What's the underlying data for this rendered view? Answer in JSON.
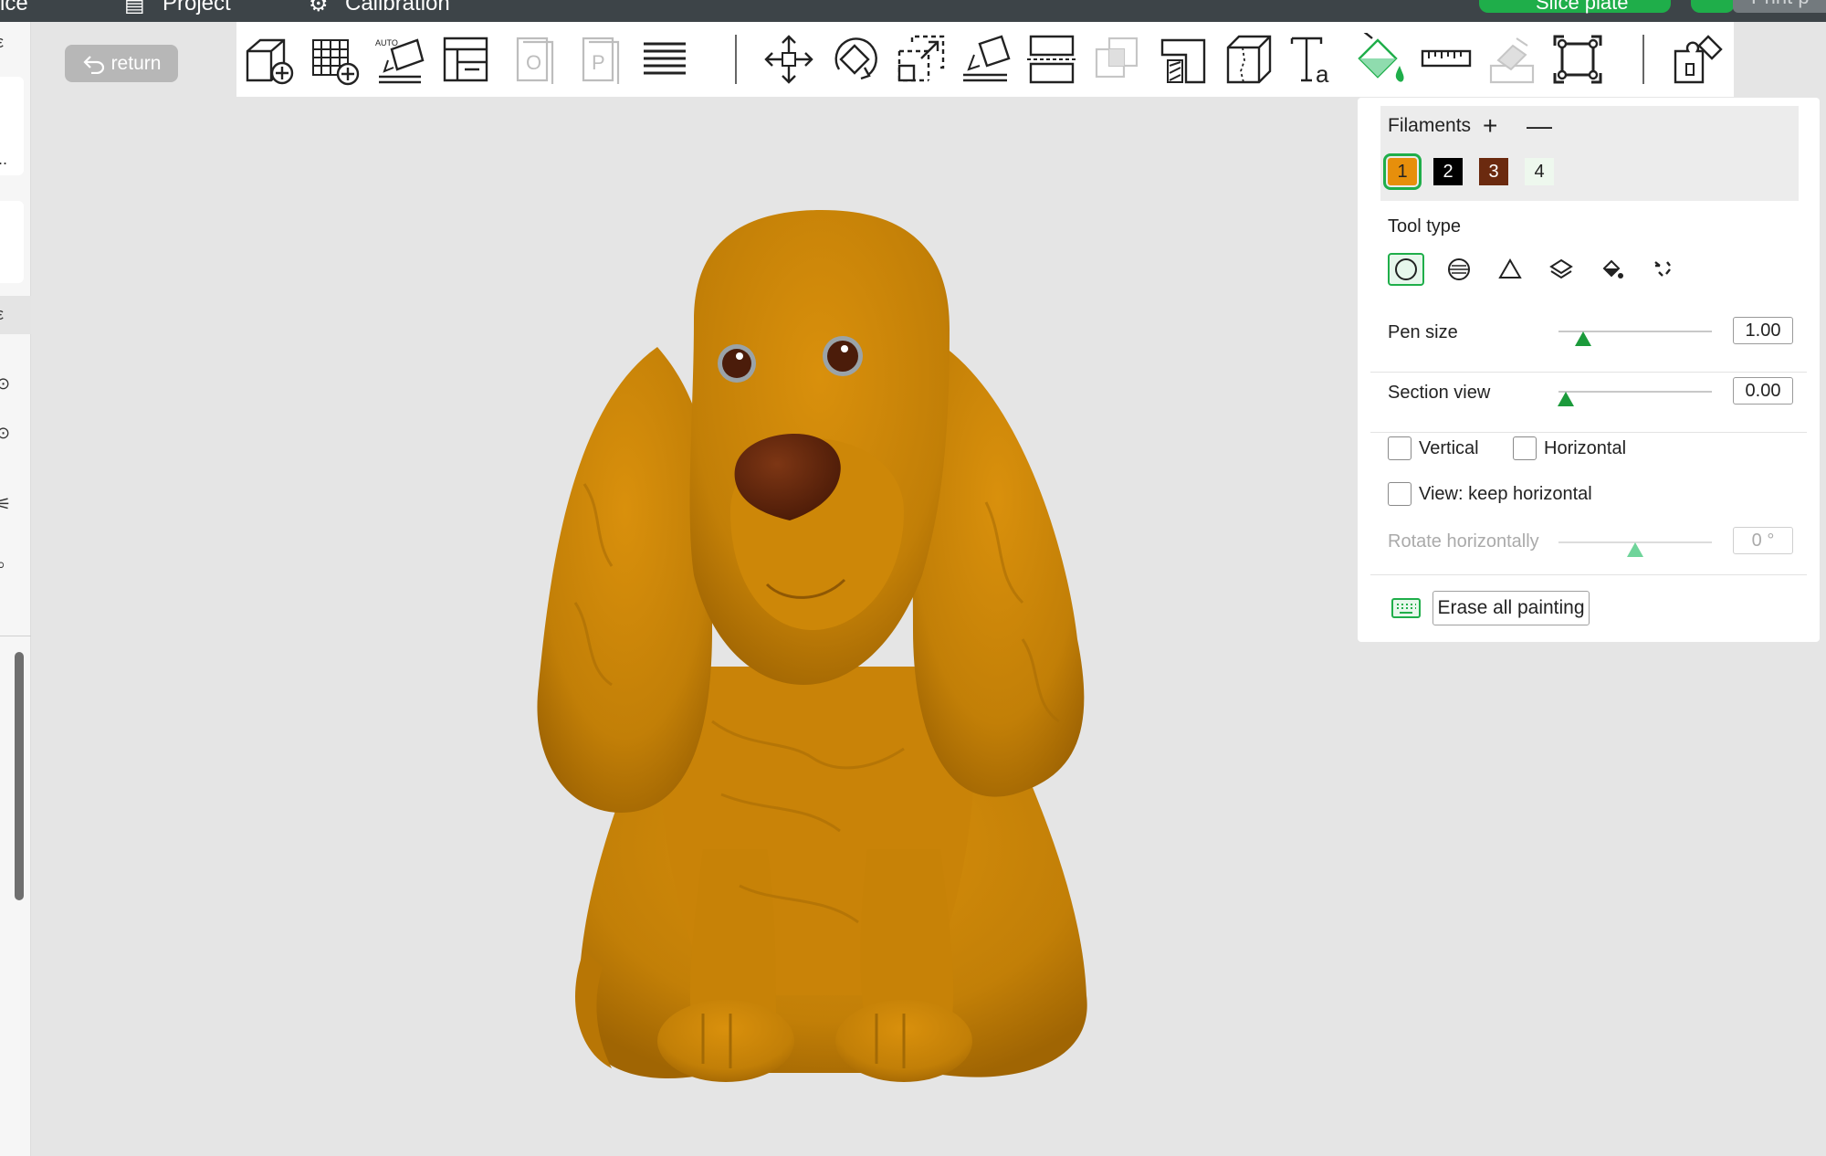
{
  "topbar": {
    "left_fragment": "ice",
    "project_label": "Project",
    "calibration_label": "Calibration",
    "slice_label": "Slice plate",
    "print_label": "Print p"
  },
  "return_label": "return",
  "toolbar": {
    "icons": [
      "add-part-icon",
      "auto-grid-add-icon",
      "auto-orient-icon",
      "arrange-icon",
      "plate-o-icon",
      "plate-p-icon",
      "menu-lines-icon",
      "move-icon",
      "rotate-icon",
      "scale-icon",
      "lay-on-face-icon",
      "split-icon",
      "boolean-icon",
      "support-paint-icon",
      "seam-paint-icon",
      "text-tool-icon",
      "color-paint-icon",
      "measure-icon",
      "assembly-icon",
      "fit-view-icon",
      "plugin-icon"
    ]
  },
  "panel": {
    "filaments_title": "Filaments",
    "add_symbol": "+",
    "remove_symbol": "—",
    "swatches": [
      {
        "label": "1",
        "color": "#e78f0b",
        "text_color": "#222222",
        "selected": true
      },
      {
        "label": "2",
        "color": "#000000",
        "text_color": "#ffffff",
        "selected": false
      },
      {
        "label": "3",
        "color": "#6b2a0f",
        "text_color": "#ffffff",
        "selected": false
      },
      {
        "label": "4",
        "color": "#eef8ee",
        "text_color": "#222222",
        "selected": false
      }
    ],
    "tool_type_title": "Tool type",
    "tool_types": [
      "circle-brush-icon",
      "sphere-brush-icon",
      "triangle-brush-icon",
      "layers-brush-icon",
      "fill-bucket-icon",
      "gap-fill-icon"
    ],
    "pen_size_label": "Pen size",
    "pen_size_value": "1.00",
    "pen_size_level": 0.16,
    "section_view_label": "Section view",
    "section_view_value": "0.00",
    "section_view_level": 0.05,
    "vertical_label": "Vertical",
    "horizontal_label": "Horizontal",
    "keep_horizontal_label": "View: keep horizontal",
    "rotate_label": "Rotate horizontally",
    "rotate_value": "0 °",
    "rotate_level": 0.5,
    "erase_label": "Erase all painting"
  },
  "colors": {
    "accent": "#1fae4a",
    "model_body": "#c98308",
    "model_nose": "#6b2a0f"
  }
}
